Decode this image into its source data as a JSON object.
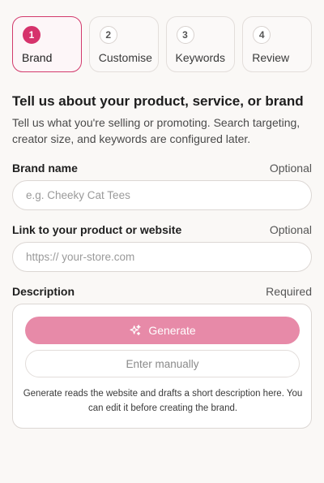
{
  "stepper": {
    "steps": [
      {
        "number": "1",
        "label": "Brand",
        "active": true
      },
      {
        "number": "2",
        "label": "Customise",
        "active": false
      },
      {
        "number": "3",
        "label": "Keywords",
        "active": false
      },
      {
        "number": "4",
        "label": "Review",
        "active": false
      }
    ]
  },
  "header": {
    "title": "Tell us about your product, service, or brand",
    "subtitle": "Tell us what you're selling or promoting. Search targeting, creator size, and keywords are configured later."
  },
  "brand_name": {
    "label": "Brand name",
    "hint": "Optional",
    "value": "",
    "placeholder": "e.g. Cheeky Cat Tees"
  },
  "link": {
    "label": "Link to your product or website",
    "hint": "Optional",
    "value": "",
    "placeholder": "https:// your-store.com"
  },
  "description": {
    "label": "Description",
    "hint": "Required",
    "generate_label": "Generate",
    "manual_label": "Enter manually",
    "note": "Generate reads the website and drafts a short description here. You can edit it before creating the brand."
  },
  "icons": {
    "generate": "sparkles-icon"
  },
  "colors": {
    "accent": "#d6336c",
    "generate_button": "#e78aa8",
    "background": "#faf8f6"
  }
}
